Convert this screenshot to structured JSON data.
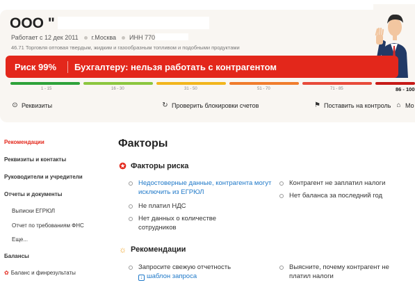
{
  "company": {
    "name": "ООО \"",
    "registered": "Работает с 12 дек 2011",
    "city": "г.Москва",
    "inn": "ИНН 770",
    "okved": "46.71 Торговля оптовая твердым, жидким и газообразным топливом и подобными продуктами"
  },
  "risk": {
    "level": "Риск 99%",
    "message": "Бухгалтеру: нельзя работать с контрагентом"
  },
  "scale": {
    "segments": [
      {
        "label": "1 - 15",
        "color": "#2ea23a"
      },
      {
        "label": "16 - 30",
        "color": "#8cc63f"
      },
      {
        "label": "31 - 50",
        "color": "#f2b51c"
      },
      {
        "label": "51 - 70",
        "color": "#f07c2c"
      },
      {
        "label": "71 - 85",
        "color": "#e84a3a"
      },
      {
        "label": "86 - 100",
        "color": "#c71a17"
      }
    ],
    "active_label": "86 - 100"
  },
  "actions": {
    "requisites": "Реквизиты",
    "check_blocks": "Проверить блокировки счетов",
    "monitor": "Поставить на контроль",
    "more": "Мо"
  },
  "sidebar": {
    "items": [
      {
        "label": "Рекомендации"
      },
      {
        "label": "Реквизиты и контакты"
      },
      {
        "label": "Руководители и учредители"
      },
      {
        "label": "Отчеты и документы"
      },
      {
        "label": "Выписки ЕГРЮЛ"
      },
      {
        "label": "Отчет по требованиям ФНС"
      },
      {
        "label": "Еще..."
      },
      {
        "label": "Балансы"
      },
      {
        "label": "Баланс и финрезультаты"
      }
    ]
  },
  "main": {
    "title": "Факторы",
    "risk_factors_title": "Факторы риска",
    "risk_factors": [
      "Недостоверные данные, контрагента могут исключить из ЕГРЮЛ",
      "Не платил НДС",
      "Нет данных о количестве сотрудников",
      "Контрагент не заплатил налоги",
      "Нет баланса за последний год"
    ],
    "recommendations_title": "Рекомендации",
    "recommendations": [
      "Запросите свежую отчетность",
      "Выясните, почему контрагент не платил налоги"
    ],
    "template_link": "шаблон запроса"
  },
  "colors": {
    "accent": "#e3271b",
    "link": "#1e78c8",
    "header_bg": "#f9f6f2"
  }
}
